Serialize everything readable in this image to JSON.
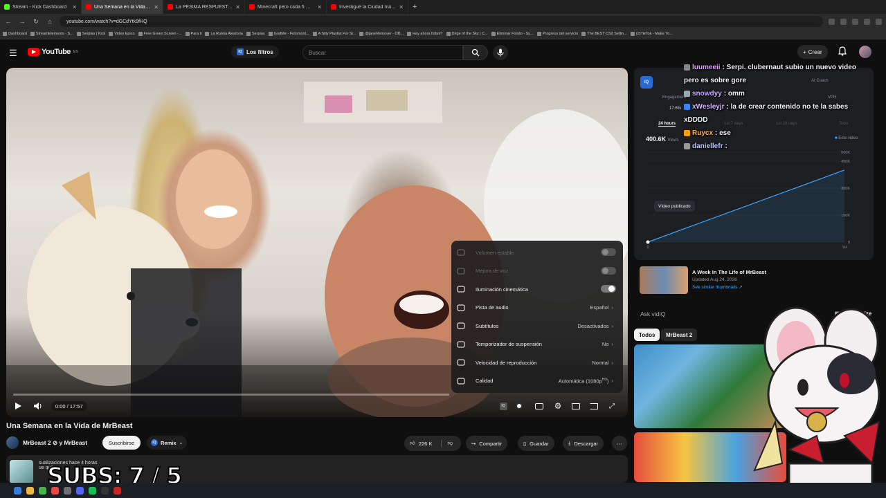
{
  "browser": {
    "tabs": [
      {
        "label": "Stream - Kick Dashboard",
        "color": "#53fc18",
        "active": false
      },
      {
        "label": "Una Semana en la Vida de MrBeast",
        "color": "#ff0000",
        "active": true
      },
      {
        "label": "La PÉSIMA RESPUESTA de JWU",
        "color": "#ff0000",
        "active": false
      },
      {
        "label": "Minecraft pero cada 5 minutos",
        "color": "#ff0000",
        "active": false
      },
      {
        "label": "Investigué la Ciudad más Obes",
        "color": "#ff0000",
        "active": false
      }
    ],
    "url": "youtube.com/watch?v=dGCdYtk9fHQ",
    "bookmarks": [
      "Dashboard",
      "StreamElements - S...",
      "Serpias | Kick",
      "Video Epico",
      "Free Green Screen -...",
      "Para ti",
      "La Ruleta Aleatoria",
      "Serpias",
      "GrafMe - Fotomont...",
      "A Silly Playlist For Si...",
      "@janeRemover - OB...",
      "Hay ahora fútbol?",
      "Dirge of the Sky | C...",
      "Eliminar Fondo - Su...",
      "Progreso del servicio",
      "The BEST CS2 Settin...",
      "(2)TikTok - Make Yo..."
    ]
  },
  "header": {
    "logo": "YouTube",
    "region": "ES",
    "filters_label": "Los filtros",
    "search_placeholder": "Buscar",
    "create_label": "Crear"
  },
  "player": {
    "time": "0:00 / 17:57",
    "progress": 0.0,
    "settings": [
      {
        "icon": "stable-volume-icon",
        "label": "Volumen estable",
        "toggle": false,
        "dim": true
      },
      {
        "icon": "voice-boost-icon",
        "label": "Mejora de voz",
        "toggle": false,
        "dim": true
      },
      {
        "icon": "ambient-mode-icon",
        "label": "Iluminación cinemática",
        "toggle": true,
        "dim": false
      },
      {
        "icon": "audio-track-icon",
        "label": "Pista de audio",
        "value": "Español"
      },
      {
        "icon": "subtitles-icon",
        "label": "Subtítulos",
        "value": "Desactivados"
      },
      {
        "icon": "sleep-timer-icon",
        "label": "Temporizador de suspensión",
        "value": "No"
      },
      {
        "icon": "playback-speed-icon",
        "label": "Velocidad de reproducción",
        "value": "Normal"
      },
      {
        "icon": "quality-icon",
        "label": "Calidad",
        "value": "Automática (1080p",
        "value_sup": "HD",
        "value_end": ")"
      }
    ]
  },
  "video": {
    "title": "Una Semana en la Vida de MrBeast",
    "channel": "MrBeast 2 ⊘ y MrBeast",
    "subscribe": "Suscribirse",
    "remix": "Remix",
    "likes": "226 K",
    "share": "Compartir",
    "save": "Guardar",
    "download": "Descargar",
    "desc_meta_1": "sualizaciones  hace 4 horas",
    "desc_meta_2": "ue          quila"
  },
  "overlay": {
    "subs": "SUBS: 7 / 5"
  },
  "vidiq": {
    "tab_engagement": "Engagement",
    "engagement_value": "17.6%",
    "tab_coach": "AI Coach",
    "tab_vph": "VPH",
    "range_24h": "24 hours",
    "range_7d": "1st 7 days",
    "range_28d": "1st 28 days",
    "range_all": "Todo",
    "views_value": "400.6K",
    "views_label": "Views",
    "legend": "Este video",
    "published_tag": "Vídeo publicado",
    "y_ticks": [
      "500K",
      "450K",
      "300K",
      "150K",
      "0"
    ],
    "x_ticks": [
      "0",
      "1H"
    ]
  },
  "chart_data": {
    "type": "line",
    "series": [
      {
        "name": "Este video",
        "x": [
          0,
          1
        ],
        "y": [
          0,
          400600
        ]
      }
    ],
    "x": [
      0,
      1
    ],
    "xlabel": "",
    "ylabel": "",
    "ylim": [
      0,
      500000
    ],
    "color": "#3ea6ff"
  },
  "chat": [
    {
      "user": "luumeeii",
      "color": "#e0a0ff",
      "text": ": Serpi. clubernaut subio un nuevo video pero es sobre gore"
    },
    {
      "user": "snowdyy",
      "color": "#c8a8ff",
      "text": ": omm"
    },
    {
      "user": "xWesleyjr",
      "color": "#d9b3ff",
      "text": ": la de crear contenido no te la sabes xDDDD"
    },
    {
      "user": "Ruycx",
      "color": "#ffb347",
      "text": ": ese"
    },
    {
      "user": "daniellefr",
      "color": "#b9c8ff",
      "text": ":"
    }
  ],
  "recommended": {
    "title": "A Week In The Life of MrBeast",
    "date": "Updated Aug 24, 2026",
    "link": "See similar thumbnails ↗",
    "ask_placeholder": "Ask vidIQ",
    "summarize": "Summarize",
    "chips": [
      "Todos",
      "MrBeast 2"
    ]
  }
}
